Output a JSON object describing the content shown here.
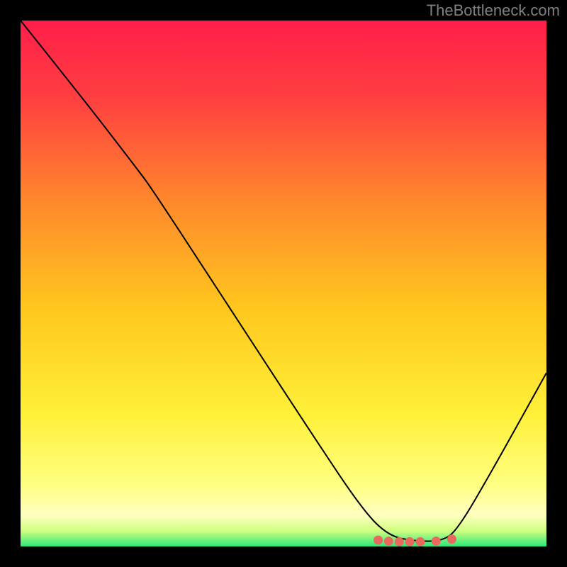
{
  "watermark": "TheBottleneck.com",
  "chart_data": {
    "type": "line",
    "title": "",
    "xlabel": "",
    "ylabel": "",
    "xlim": [
      0,
      100
    ],
    "ylim": [
      0,
      100
    ],
    "background_gradient": {
      "type": "vertical",
      "stops": [
        {
          "pos": 0.0,
          "color": "#ff1e4a"
        },
        {
          "pos": 0.15,
          "color": "#ff4040"
        },
        {
          "pos": 0.35,
          "color": "#ff8a2b"
        },
        {
          "pos": 0.55,
          "color": "#ffc81e"
        },
        {
          "pos": 0.75,
          "color": "#fff03a"
        },
        {
          "pos": 0.88,
          "color": "#ffff80"
        },
        {
          "pos": 0.94,
          "color": "#ffffc0"
        },
        {
          "pos": 0.97,
          "color": "#d0ff80"
        },
        {
          "pos": 1.0,
          "color": "#2ce87a"
        }
      ]
    },
    "series": [
      {
        "name": "curve",
        "color": "#000000",
        "points": [
          {
            "x": 0,
            "y": 100
          },
          {
            "x": 12,
            "y": 85
          },
          {
            "x": 22,
            "y": 72
          },
          {
            "x": 25,
            "y": 68
          },
          {
            "x": 40,
            "y": 45
          },
          {
            "x": 55,
            "y": 22
          },
          {
            "x": 65,
            "y": 7
          },
          {
            "x": 70,
            "y": 2
          },
          {
            "x": 75,
            "y": 1
          },
          {
            "x": 80,
            "y": 1
          },
          {
            "x": 83,
            "y": 3
          },
          {
            "x": 90,
            "y": 15
          },
          {
            "x": 100,
            "y": 33
          }
        ]
      }
    ],
    "markers": [
      {
        "x": 68,
        "y": 1.2,
        "color": "#e86a5e"
      },
      {
        "x": 70,
        "y": 1.0,
        "color": "#e86a5e"
      },
      {
        "x": 72,
        "y": 0.9,
        "color": "#e86a5e"
      },
      {
        "x": 74,
        "y": 0.9,
        "color": "#e86a5e"
      },
      {
        "x": 76,
        "y": 0.9,
        "color": "#e86a5e"
      },
      {
        "x": 79,
        "y": 1.0,
        "color": "#e86a5e"
      },
      {
        "x": 82,
        "y": 1.4,
        "color": "#e86a5e"
      }
    ]
  }
}
